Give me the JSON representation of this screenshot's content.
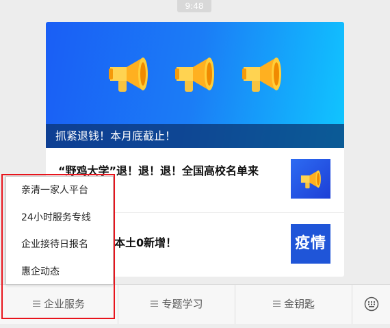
{
  "status": {
    "time": "9:48"
  },
  "banner": {
    "caption": "抓紧退钱！本月底截止！",
    "icon": "megaphone-icon",
    "colors": {
      "gradient_start": "#1a5ef5",
      "gradient_end": "#10c6ff"
    }
  },
  "articles": [
    {
      "title": "“野鸡大学”退！退！退！全国高校名单来",
      "thumb_icon": "megaphone-icon"
    },
    {
      "title": "本土0新增！",
      "thumb_text": "疫情"
    }
  ],
  "menu": {
    "items": [
      {
        "label": "亲清一家人平台"
      },
      {
        "label": "24小时服务专线"
      },
      {
        "label": "企业接待日报名"
      },
      {
        "label": "惠企动态"
      }
    ]
  },
  "bottom_bar": {
    "tabs": [
      {
        "label": "企业服务",
        "icon": "menu-icon"
      },
      {
        "label": "专题学习",
        "icon": "menu-icon"
      },
      {
        "label": "金钥匙",
        "icon": "menu-icon"
      }
    ],
    "keyboard_icon": "keyboard-icon"
  },
  "highlight_color": "#e8141c"
}
